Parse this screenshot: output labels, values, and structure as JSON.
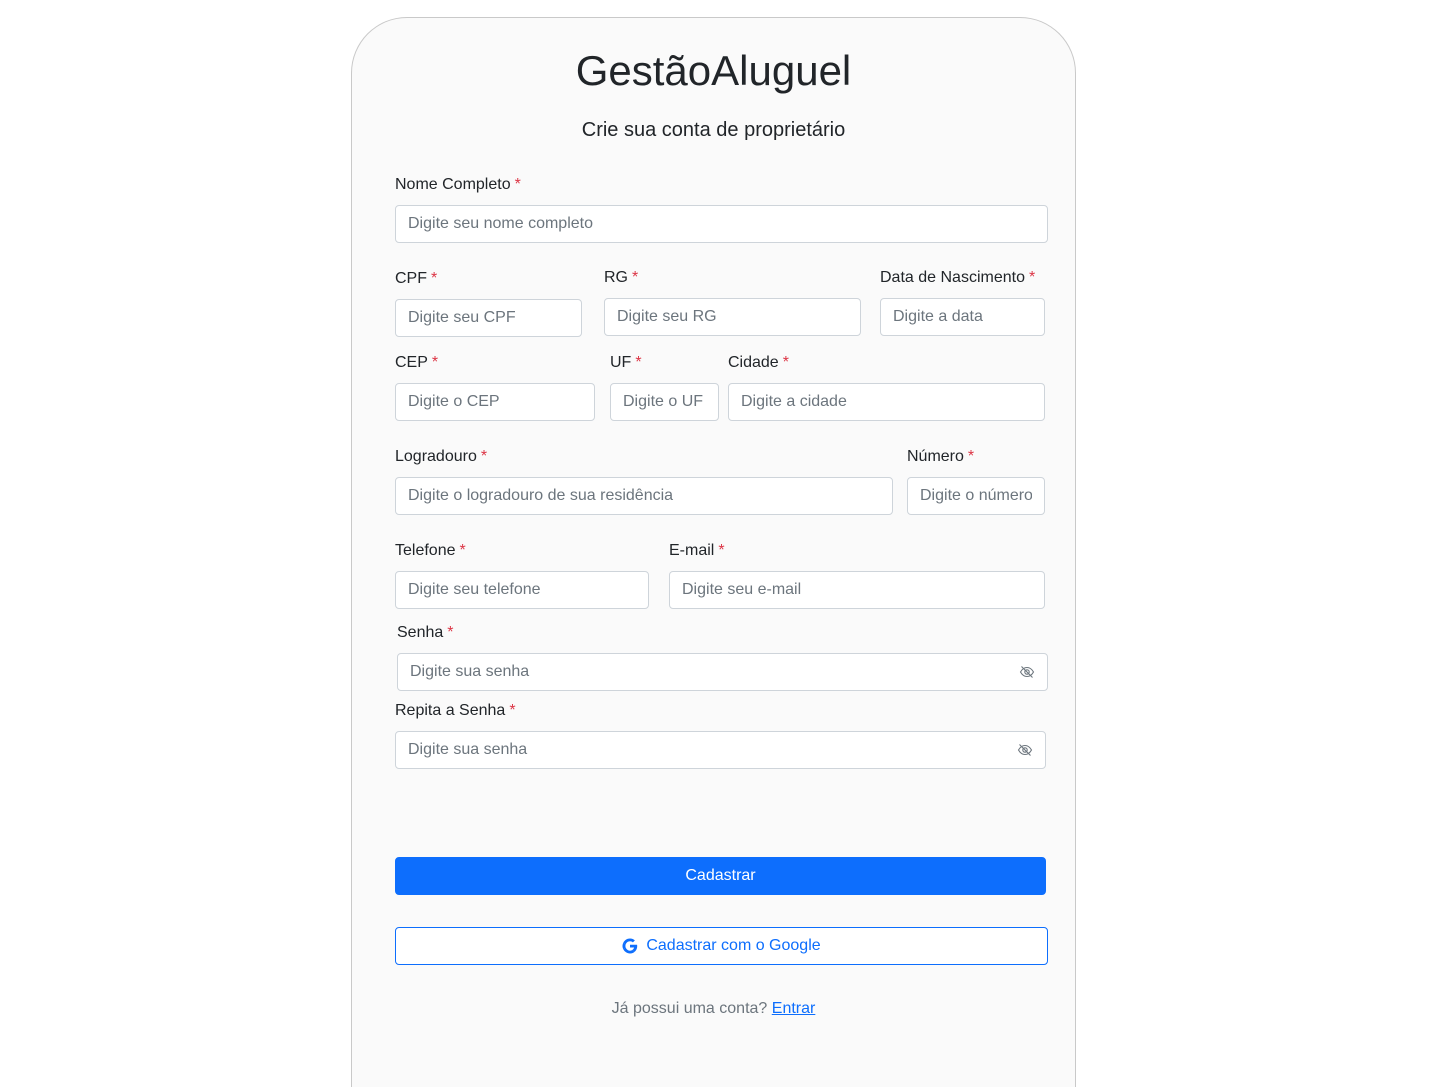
{
  "app": {
    "title": "GestãoAluguel",
    "subtitle": "Crie sua conta de proprietário"
  },
  "form": {
    "required_mark": "*",
    "nome": {
      "label": "Nome Completo",
      "placeholder": "Digite seu nome completo",
      "value": ""
    },
    "cpf": {
      "label": "CPF",
      "placeholder": "Digite seu CPF",
      "value": ""
    },
    "rg": {
      "label": "RG",
      "placeholder": "Digite seu RG",
      "value": ""
    },
    "nascimento": {
      "label": "Data de Nascimento",
      "placeholder": "Digite a data",
      "value": ""
    },
    "cep": {
      "label": "CEP",
      "placeholder": "Digite o CEP",
      "value": ""
    },
    "uf": {
      "label": "UF",
      "placeholder": "Digite o UF",
      "value": ""
    },
    "cidade": {
      "label": "Cidade",
      "placeholder": "Digite a cidade",
      "value": ""
    },
    "logradouro": {
      "label": "Logradouro",
      "placeholder": "Digite o logradouro de sua residência",
      "value": ""
    },
    "numero": {
      "label": "Número",
      "placeholder": "Digite o número",
      "value": ""
    },
    "telefone": {
      "label": "Telefone",
      "placeholder": "Digite seu telefone",
      "value": ""
    },
    "email": {
      "label": "E-mail",
      "placeholder": "Digite seu e-mail",
      "value": ""
    },
    "senha": {
      "label": "Senha",
      "placeholder": "Digite sua senha",
      "value": "",
      "toggle_icon": "eye-slash-icon"
    },
    "repita_senha": {
      "label": "Repita a Senha",
      "placeholder": "Digite sua senha",
      "value": "",
      "toggle_icon": "eye-slash-icon"
    }
  },
  "actions": {
    "submit_label": "Cadastrar",
    "google_label": "Cadastrar com o Google",
    "google_icon": "google-icon"
  },
  "footer": {
    "text": "Já possui uma conta?",
    "link_label": "Entrar"
  },
  "colors": {
    "primary": "#0d6efd",
    "required": "#dc3545",
    "placeholder": "#6c757d",
    "card_bg": "#fafafa"
  }
}
